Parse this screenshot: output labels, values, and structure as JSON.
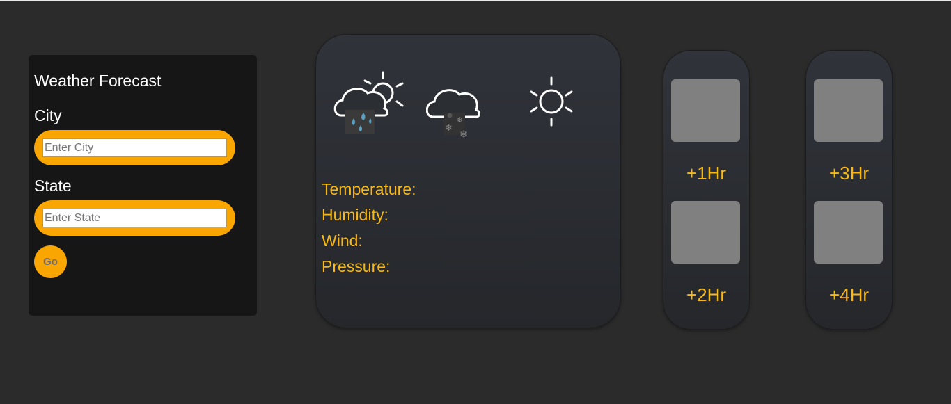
{
  "search_panel": {
    "title": "Weather Forecast",
    "city_label": "City",
    "city_placeholder": "Enter City",
    "city_value": "",
    "state_label": "State",
    "state_placeholder": "Enter State",
    "state_value": "",
    "go_label": "Go"
  },
  "main_card": {
    "icons": [
      "rain-sun-icon",
      "snow-cloud-icon",
      "sun-icon"
    ],
    "stats": {
      "temperature": "Temperature:",
      "humidity": "Humidity:",
      "wind": "Wind:",
      "pressure": "Pressure:"
    }
  },
  "hourly": [
    {
      "label": "+1Hr"
    },
    {
      "label": "+2Hr"
    },
    {
      "label": "+3Hr"
    },
    {
      "label": "+4Hr"
    }
  ],
  "colors": {
    "accent": "#f9a602",
    "stat_text": "#f9b915",
    "background": "#2b2b2b",
    "panel": "#161616",
    "placeholder_box": "#808080"
  }
}
